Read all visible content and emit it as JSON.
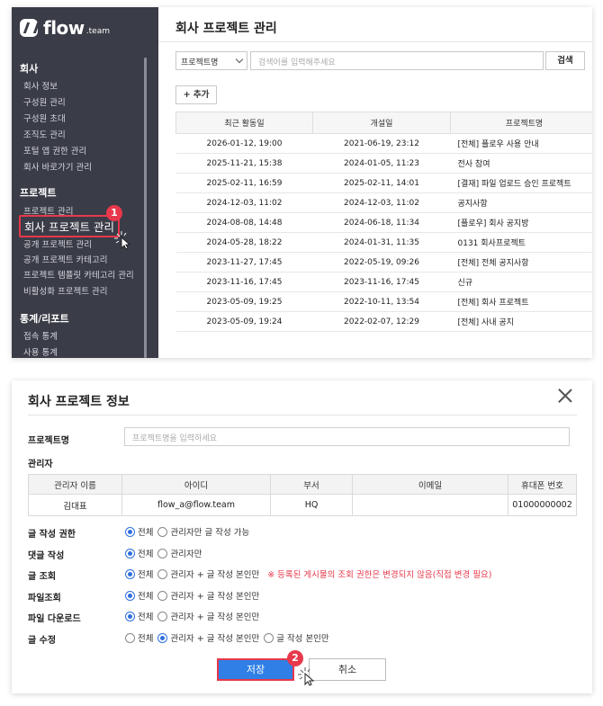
{
  "brand": {
    "name": "flow",
    "suffix": ".team"
  },
  "sidebar": {
    "sections": [
      {
        "title": "회사",
        "items": [
          "회사 정보",
          "구성원 관리",
          "구성원 초대",
          "조직도 관리",
          "포털 앱 권한 관리",
          "회사 바로가기 관리"
        ]
      },
      {
        "title": "프로젝트",
        "items": [
          "프로젝트 관리",
          "회사 프로젝트 관리",
          "공개 프로젝트 관리",
          "공개 프로젝트 카테고리",
          "프로젝트 템플릿 카테고리 관리",
          "비활성화 프로젝트 관리"
        ]
      },
      {
        "title": "통계/리포트",
        "items": [
          "접속 통계",
          "사용 통계"
        ]
      }
    ],
    "active_item": "회사 프로젝트 관리",
    "step_badge": "1"
  },
  "list_page": {
    "title": "회사 프로젝트 관리",
    "filter_select": "프로젝트명",
    "search_placeholder": "검색어를 입력해주세요",
    "search_button": "검색",
    "add_button": "+ 추가",
    "columns": [
      "최근 활동일",
      "개설일",
      "프로젝트명"
    ],
    "rows": [
      [
        "2026-01-12, 19:00",
        "2021-06-19, 23:12",
        "[전체] 플로우 사용 안내"
      ],
      [
        "2025-11-21, 15:38",
        "2024-01-05, 11:23",
        "전사 참여"
      ],
      [
        "2025-02-11, 16:59",
        "2025-02-11, 14:01",
        "[결재] 파일 업로드 승인 프로젝트"
      ],
      [
        "2024-12-03, 11:02",
        "2024-12-03, 11:02",
        "공지사항"
      ],
      [
        "2024-08-08, 14:48",
        "2024-06-18, 11:34",
        "[플로우] 회사 공지방"
      ],
      [
        "2024-05-28, 18:22",
        "2024-01-31, 11:35",
        "0131 회사프로젝트"
      ],
      [
        "2023-11-27, 17:45",
        "2022-05-19, 09:26",
        "[전체] 전체 공지사항"
      ],
      [
        "2023-11-16, 17:45",
        "2023-11-16, 17:45",
        "신규"
      ],
      [
        "2023-05-09, 19:25",
        "2022-10-11, 13:54",
        "[전체] 회사 프로젝트"
      ],
      [
        "2023-05-09, 19:24",
        "2022-02-07, 12:29",
        "[전체] 사내 공지"
      ]
    ]
  },
  "modal": {
    "title": "회사 프로젝트 정보",
    "project_name_label": "프로젝트명",
    "project_name_placeholder": "프로젝트명을 입력하세요",
    "admin_label": "관리자",
    "admin_columns": [
      "관리자 이름",
      "아이디",
      "부서",
      "이메일",
      "휴대폰 번호"
    ],
    "admin_rows": [
      [
        "김대표",
        "flow_a@flow.team",
        "HQ",
        "",
        "01000000002"
      ]
    ],
    "permissions": [
      {
        "label": "글 작성 권한",
        "options": [
          "전체",
          "관리자만 글 작성 가능"
        ],
        "selected": 0,
        "note": ""
      },
      {
        "label": "댓글 작성",
        "options": [
          "전체",
          "관리자만"
        ],
        "selected": 0,
        "note": ""
      },
      {
        "label": "글 조회",
        "options": [
          "전체",
          "관리자 + 글 작성 본인만"
        ],
        "selected": 0,
        "note": "※ 등록된 게시물의 조회 권한은 변경되지 않음(직접 변경 필요)"
      },
      {
        "label": "파일조회",
        "options": [
          "전체",
          "관리자 + 글 작성 본인만"
        ],
        "selected": 0,
        "note": ""
      },
      {
        "label": "파일 다운로드",
        "options": [
          "전체",
          "관리자 + 글 작성 본인만"
        ],
        "selected": 0,
        "note": ""
      },
      {
        "label": "글 수정",
        "options": [
          "전체",
          "관리자 + 글 작성 본인만",
          "글 작성 본인만"
        ],
        "selected": 1,
        "note": ""
      }
    ],
    "save_button": "저장",
    "cancel_button": "취소",
    "step_badge": "2"
  },
  "colors": {
    "sidebar_bg": "#3a3c47",
    "accent_blue": "#2f7fe6",
    "highlight_red": "#e8384b",
    "radio_blue": "#2f6fde"
  }
}
